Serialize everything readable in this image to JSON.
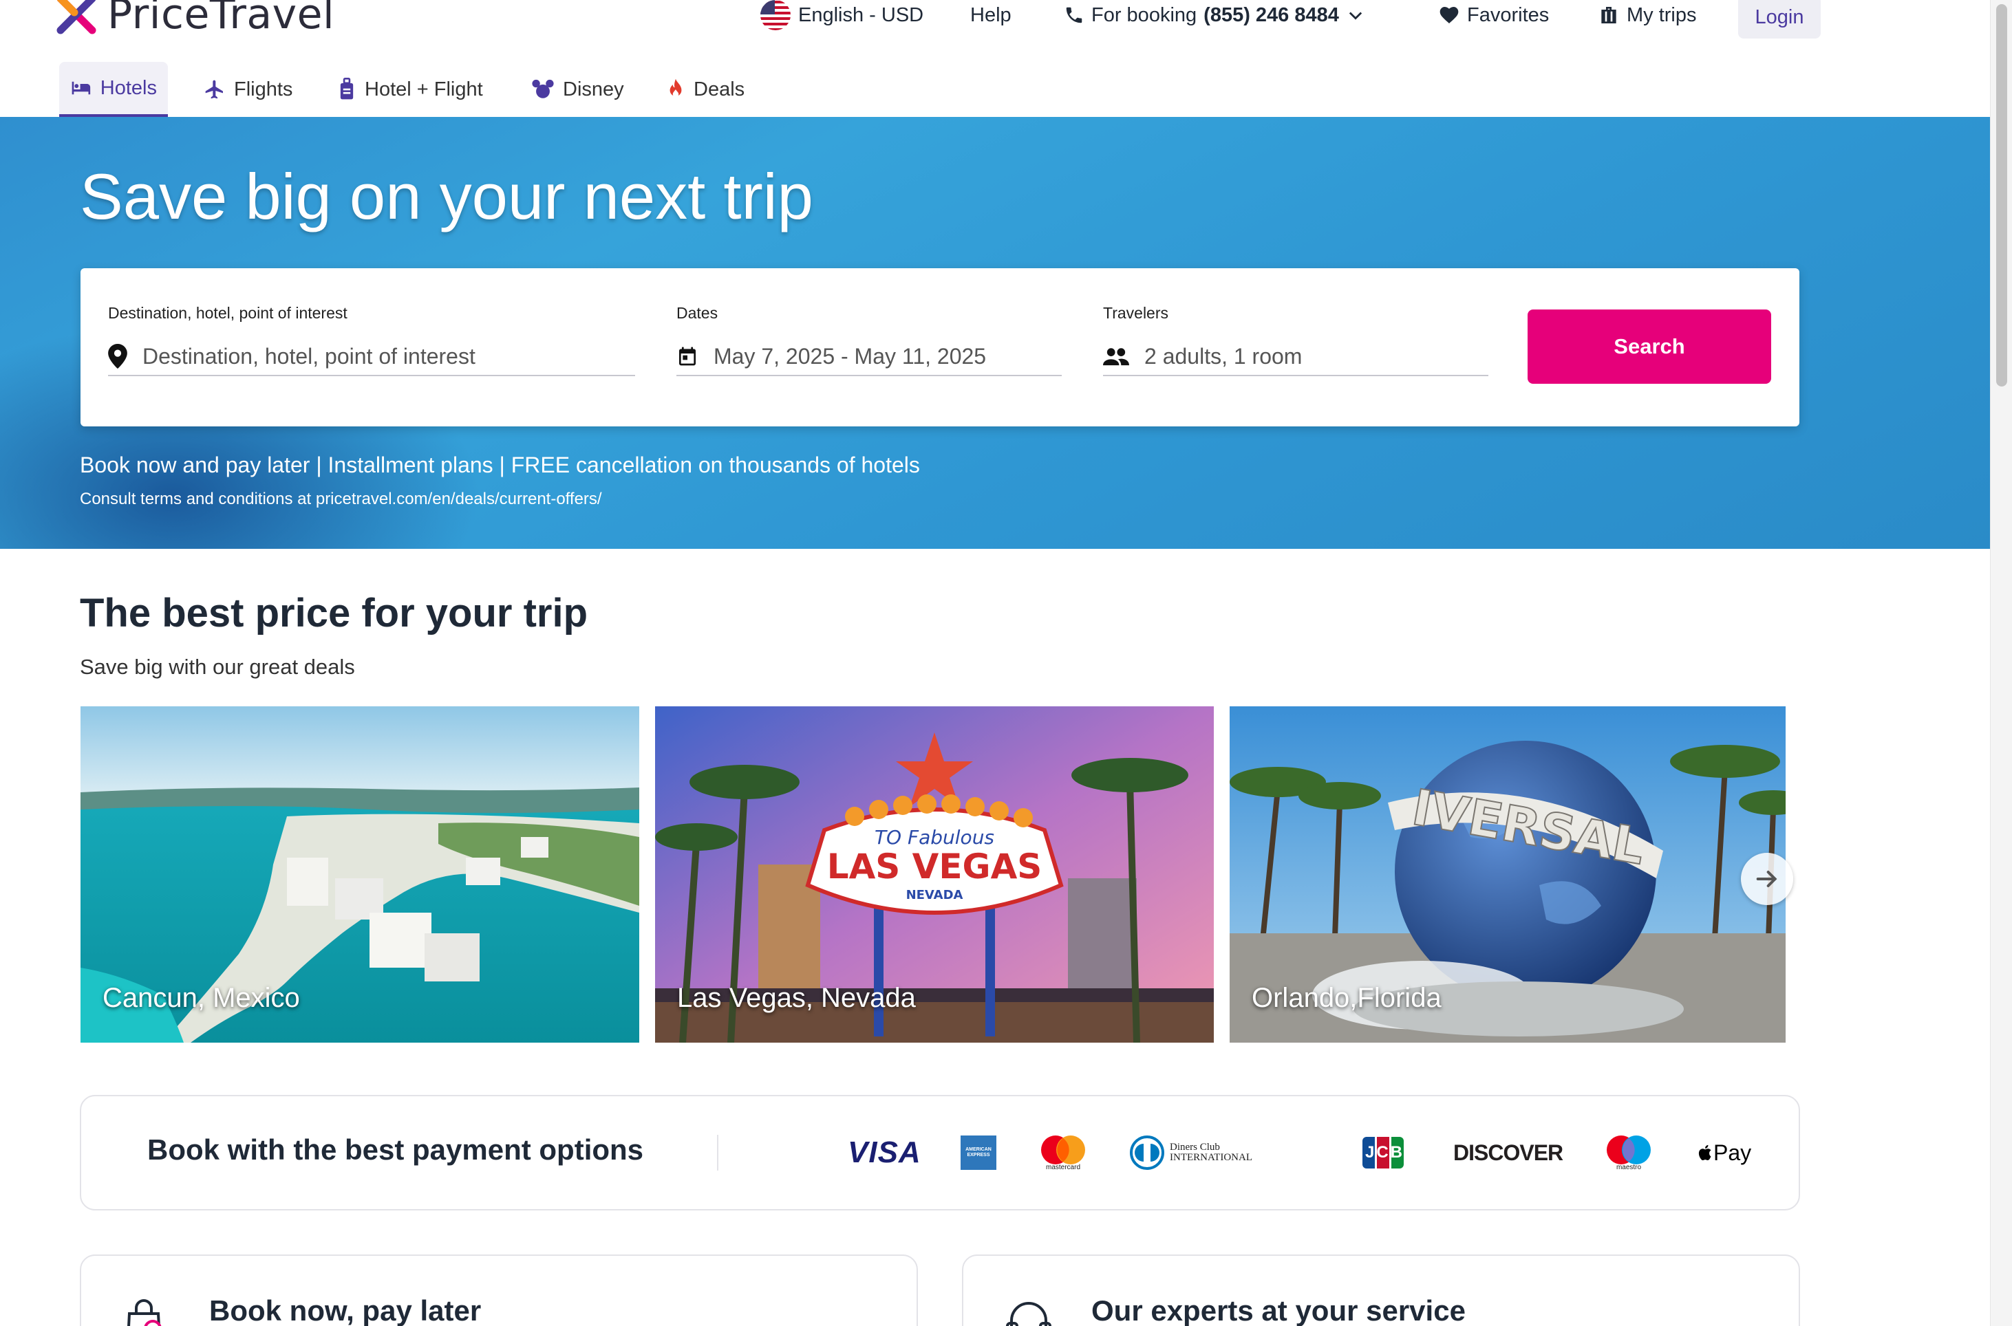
{
  "brand": {
    "name": "PriceTravel"
  },
  "utility_nav": {
    "language": "English - USD",
    "help": "Help",
    "booking_prefix": "For booking",
    "booking_phone": "(855) 246 8484",
    "favorites": "Favorites",
    "my_trips": "My trips",
    "login": "Login"
  },
  "tabs": [
    {
      "label": "Hotels",
      "icon": "bed-icon",
      "active": true
    },
    {
      "label": "Flights",
      "icon": "plane-icon",
      "active": false
    },
    {
      "label": "Hotel + Flight",
      "icon": "luggage-icon",
      "active": false
    },
    {
      "label": "Disney",
      "icon": "mickey-icon",
      "active": false
    },
    {
      "label": "Deals",
      "icon": "flame-icon",
      "active": false
    }
  ],
  "hero": {
    "title": "Save big on your next trip",
    "promo": "Book now and pay later | Installment plans | FREE cancellation on thousands of hotels",
    "terms": "Consult terms and conditions at pricetravel.com/en/deals/current-offers/"
  },
  "search": {
    "destination_label": "Destination, hotel, point of interest",
    "destination_placeholder": "Destination, hotel, point of interest",
    "dates_label": "Dates",
    "dates_value": "May 7, 2025 - May 11, 2025",
    "travelers_label": "Travelers",
    "travelers_value": "2 adults, 1 room",
    "button": "Search"
  },
  "deals": {
    "title": "The best price for your trip",
    "subtitle": "Save big with our great deals",
    "destinations": [
      {
        "name": "Cancun, Mexico"
      },
      {
        "name": "Las Vegas, Nevada"
      },
      {
        "name": "Orlando,Florida"
      }
    ]
  },
  "payment": {
    "title": "Book with the best payment options",
    "methods": [
      "VISA",
      "AMERICAN EXPRESS",
      "mastercard",
      "Diners Club INTERNATIONAL",
      "JCB",
      "DISCOVER",
      "maestro",
      "Pay"
    ]
  },
  "info_cards": [
    {
      "title": "Book now, pay later",
      "icon": "shopping-bag-clock-icon"
    },
    {
      "title": "Our experts at your service",
      "icon": "headset-icon"
    }
  ],
  "colors": {
    "brand_purple": "#4b3aa0",
    "search_button": "#e6007a",
    "hero_blue": "#36a3da"
  }
}
